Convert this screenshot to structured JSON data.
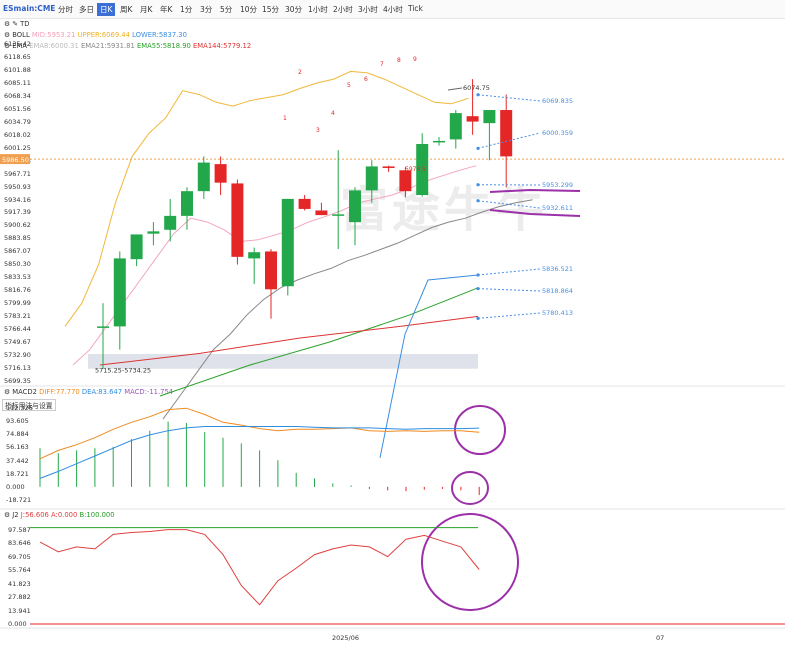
{
  "toolbar": {
    "symbol": "ESmain:CME",
    "periods": [
      "分时",
      "多日",
      "日K",
      "周K",
      "月K",
      "年K",
      "1分",
      "3分",
      "5分",
      "10分",
      "15分",
      "30分",
      "1小时",
      "2小时",
      "3小时",
      "4小时",
      "Tick"
    ],
    "active": "日K"
  },
  "indicators": {
    "td": "TD",
    "boll": {
      "name": "BOLL",
      "mid": "MID:5953.21",
      "upper": "UPPER:6069.44",
      "lower": "LOWER:5837.30"
    },
    "ema": {
      "name": "EMA",
      "ema8": "EMA8:6000.31",
      "ema21": "EMA21:5931.81",
      "ema55": "EMA55:5818.90",
      "ema144": "EMA144:5779.12"
    },
    "macd": {
      "name": "MACD2",
      "diff": "DIFF:77.770",
      "dea": "DEA:83.647",
      "macd": "MACD:-11.754"
    },
    "help": "指标用法与设置",
    "j2": {
      "name": "J2",
      "j": "J:56.606",
      "a": "A:0.000",
      "b": "B:100.000"
    }
  },
  "axes": {
    "price_ticks": [
      "6135.42",
      "6118.65",
      "6101.88",
      "6085.11",
      "6068.34",
      "6051.56",
      "6034.79",
      "6018.02",
      "6001.25",
      "5984.48",
      "5967.71",
      "5950.93",
      "5934.16",
      "5917.39",
      "5900.62",
      "5883.85",
      "5867.07",
      "5850.30",
      "5833.53",
      "5816.76",
      "5799.99",
      "5783.21",
      "5766.44",
      "5749.67",
      "5732.90",
      "5716.13",
      "5699.35"
    ],
    "current_price": "5986.50",
    "macd_ticks": [
      "112.326",
      "93.605",
      "74.884",
      "56.163",
      "37.442",
      "18.721",
      "0.000",
      "-18.721"
    ],
    "j_ticks": [
      "97.587",
      "83.646",
      "69.705",
      "55.764",
      "41.823",
      "27.882",
      "13.941",
      "0.000"
    ],
    "date_labels": [
      "2025/06",
      "07"
    ]
  },
  "annotations": {
    "hi": "6074.75",
    "lo_range": "5715.25-5734.25",
    "boll_lbl": "5976.5",
    "dashed": [
      "6069.835",
      "6000.359",
      "5953.299",
      "5932.611",
      "5836.521",
      "5818.864",
      "5780.413"
    ],
    "td_counts": [
      "1",
      "2",
      "3",
      "4",
      "5",
      "6",
      "7",
      "8",
      "9"
    ]
  },
  "watermark": "富途牛牛",
  "chart_data": {
    "type": "candlestick",
    "candles": [
      {
        "o": 5770,
        "h": 5800,
        "l": 5715,
        "c": 5770
      },
      {
        "o": 5770,
        "h": 5867,
        "l": 5740,
        "c": 5858
      },
      {
        "o": 5857,
        "h": 5885,
        "l": 5848,
        "c": 5889
      },
      {
        "o": 5890,
        "h": 5905,
        "l": 5875,
        "c": 5893
      },
      {
        "o": 5895,
        "h": 5935,
        "l": 5880,
        "c": 5913
      },
      {
        "o": 5913,
        "h": 5950,
        "l": 5895,
        "c": 5945
      },
      {
        "o": 5945,
        "h": 5990,
        "l": 5935,
        "c": 5982
      },
      {
        "o": 5980,
        "h": 5990,
        "l": 5940,
        "c": 5956
      },
      {
        "o": 5955,
        "h": 5960,
        "l": 5850,
        "c": 5860
      },
      {
        "o": 5858,
        "h": 5872,
        "l": 5825,
        "c": 5866
      },
      {
        "o": 5867,
        "h": 5870,
        "l": 5780,
        "c": 5818
      },
      {
        "o": 5822,
        "h": 5935,
        "l": 5810,
        "c": 5935
      },
      {
        "o": 5935,
        "h": 5940,
        "l": 5920,
        "c": 5922
      },
      {
        "o": 5920,
        "h": 5930,
        "l": 5915,
        "c": 5914
      },
      {
        "o": 5915,
        "h": 5998,
        "l": 5870,
        "c": 5915
      },
      {
        "o": 5905,
        "h": 5950,
        "l": 5875,
        "c": 5946
      },
      {
        "o": 5946,
        "h": 5985,
        "l": 5930,
        "c": 5977
      },
      {
        "o": 5977,
        "h": 5978,
        "l": 5970,
        "c": 5975
      },
      {
        "o": 5972,
        "h": 5976,
        "l": 5937,
        "c": 5945
      },
      {
        "o": 5940,
        "h": 6020,
        "l": 5938,
        "c": 6006
      },
      {
        "o": 6009,
        "h": 6015,
        "l": 6004,
        "c": 6010
      },
      {
        "o": 6012,
        "h": 6050,
        "l": 6000,
        "c": 6046
      },
      {
        "o": 6042,
        "h": 6090,
        "l": 6018,
        "c": 6035
      },
      {
        "o": 6033,
        "h": 6048,
        "l": 5985,
        "c": 6050
      },
      {
        "o": 6050,
        "h": 6070,
        "l": 5950,
        "c": 5990
      }
    ],
    "macd_hist": [
      55,
      48,
      52,
      55,
      57,
      68,
      80,
      93,
      91,
      78,
      70,
      62,
      52,
      38,
      20,
      12,
      5,
      2,
      -3,
      -5,
      -6,
      -4,
      -3,
      -5,
      -11.754
    ],
    "diff": [
      40,
      52,
      60,
      70,
      82,
      92,
      100,
      110,
      112,
      103,
      92,
      88,
      83,
      80,
      82,
      82,
      83,
      84,
      80,
      79,
      80,
      79,
      80,
      80,
      77.77
    ],
    "dea": [
      12,
      22,
      33,
      44,
      55,
      66,
      74,
      80,
      84,
      86,
      86,
      86,
      86,
      86,
      86,
      85,
      84,
      84,
      84,
      83,
      82,
      83,
      83,
      83,
      83.647
    ],
    "j": [
      85,
      75,
      80,
      78,
      93,
      95,
      96,
      98,
      98,
      93,
      72,
      40,
      20,
      45,
      58,
      72,
      78,
      82,
      80,
      70,
      88,
      92,
      86,
      80,
      56.606
    ]
  }
}
